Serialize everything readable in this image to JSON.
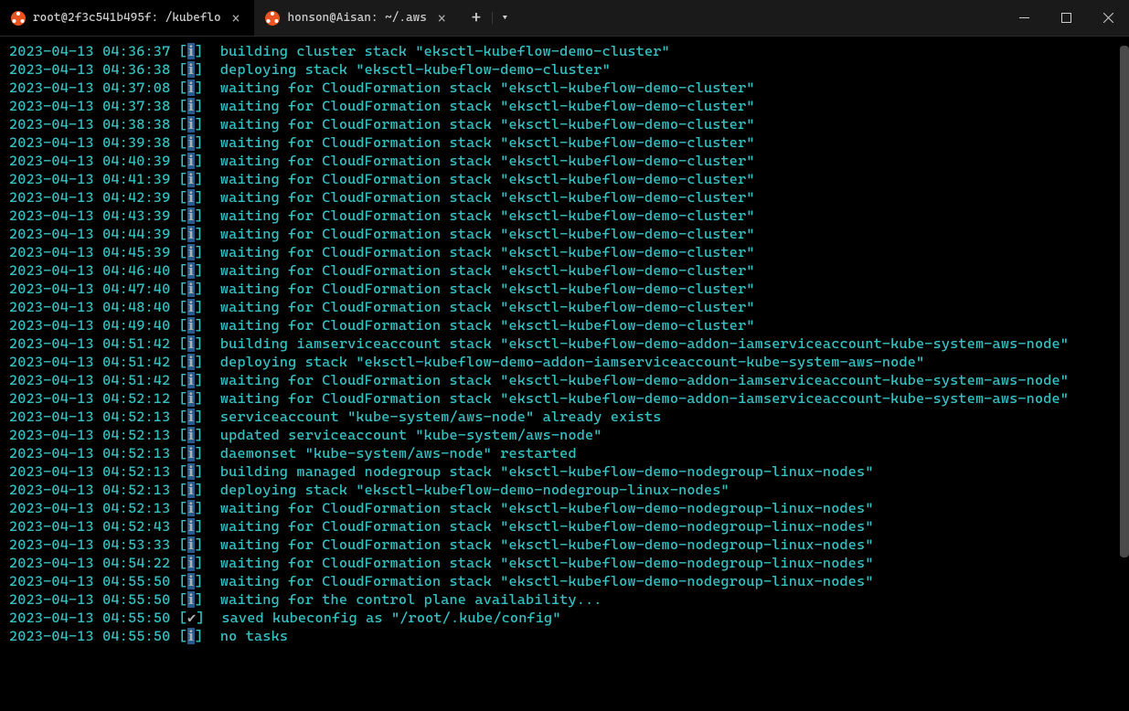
{
  "tabs": [
    {
      "icon": "ubuntu",
      "title": "root@2f3c541b495f: /kubeflo",
      "active": true
    },
    {
      "icon": "ubuntu",
      "title": "honson@Aisan: ~/.aws",
      "active": false
    }
  ],
  "window_controls": {
    "minimize": "minimize",
    "maximize": "maximize",
    "close": "close"
  },
  "log_lines": [
    {
      "ts": "2023-04-13 04:36:37",
      "level": "ℹ",
      "msg": "building cluster stack \"eksctl-kubeflow-demo-cluster\""
    },
    {
      "ts": "2023-04-13 04:36:38",
      "level": "ℹ",
      "msg": "deploying stack \"eksctl-kubeflow-demo-cluster\""
    },
    {
      "ts": "2023-04-13 04:37:08",
      "level": "ℹ",
      "msg": "waiting for CloudFormation stack \"eksctl-kubeflow-demo-cluster\""
    },
    {
      "ts": "2023-04-13 04:37:38",
      "level": "ℹ",
      "msg": "waiting for CloudFormation stack \"eksctl-kubeflow-demo-cluster\""
    },
    {
      "ts": "2023-04-13 04:38:38",
      "level": "ℹ",
      "msg": "waiting for CloudFormation stack \"eksctl-kubeflow-demo-cluster\""
    },
    {
      "ts": "2023-04-13 04:39:38",
      "level": "ℹ",
      "msg": "waiting for CloudFormation stack \"eksctl-kubeflow-demo-cluster\""
    },
    {
      "ts": "2023-04-13 04:40:39",
      "level": "ℹ",
      "msg": "waiting for CloudFormation stack \"eksctl-kubeflow-demo-cluster\""
    },
    {
      "ts": "2023-04-13 04:41:39",
      "level": "ℹ",
      "msg": "waiting for CloudFormation stack \"eksctl-kubeflow-demo-cluster\""
    },
    {
      "ts": "2023-04-13 04:42:39",
      "level": "ℹ",
      "msg": "waiting for CloudFormation stack \"eksctl-kubeflow-demo-cluster\""
    },
    {
      "ts": "2023-04-13 04:43:39",
      "level": "ℹ",
      "msg": "waiting for CloudFormation stack \"eksctl-kubeflow-demo-cluster\""
    },
    {
      "ts": "2023-04-13 04:44:39",
      "level": "ℹ",
      "msg": "waiting for CloudFormation stack \"eksctl-kubeflow-demo-cluster\""
    },
    {
      "ts": "2023-04-13 04:45:39",
      "level": "ℹ",
      "msg": "waiting for CloudFormation stack \"eksctl-kubeflow-demo-cluster\""
    },
    {
      "ts": "2023-04-13 04:46:40",
      "level": "ℹ",
      "msg": "waiting for CloudFormation stack \"eksctl-kubeflow-demo-cluster\""
    },
    {
      "ts": "2023-04-13 04:47:40",
      "level": "ℹ",
      "msg": "waiting for CloudFormation stack \"eksctl-kubeflow-demo-cluster\""
    },
    {
      "ts": "2023-04-13 04:48:40",
      "level": "ℹ",
      "msg": "waiting for CloudFormation stack \"eksctl-kubeflow-demo-cluster\""
    },
    {
      "ts": "2023-04-13 04:49:40",
      "level": "ℹ",
      "msg": "waiting for CloudFormation stack \"eksctl-kubeflow-demo-cluster\""
    },
    {
      "ts": "2023-04-13 04:51:42",
      "level": "ℹ",
      "msg": "building iamserviceaccount stack \"eksctl-kubeflow-demo-addon-iamserviceaccount-kube-system-aws-node\""
    },
    {
      "ts": "2023-04-13 04:51:42",
      "level": "ℹ",
      "msg": "deploying stack \"eksctl-kubeflow-demo-addon-iamserviceaccount-kube-system-aws-node\""
    },
    {
      "ts": "2023-04-13 04:51:42",
      "level": "ℹ",
      "msg": "waiting for CloudFormation stack \"eksctl-kubeflow-demo-addon-iamserviceaccount-kube-system-aws-node\""
    },
    {
      "ts": "2023-04-13 04:52:12",
      "level": "ℹ",
      "msg": "waiting for CloudFormation stack \"eksctl-kubeflow-demo-addon-iamserviceaccount-kube-system-aws-node\""
    },
    {
      "ts": "2023-04-13 04:52:13",
      "level": "ℹ",
      "msg": "serviceaccount \"kube-system/aws-node\" already exists"
    },
    {
      "ts": "2023-04-13 04:52:13",
      "level": "ℹ",
      "msg": "updated serviceaccount \"kube-system/aws-node\""
    },
    {
      "ts": "2023-04-13 04:52:13",
      "level": "ℹ",
      "msg": "daemonset \"kube-system/aws-node\" restarted"
    },
    {
      "ts": "2023-04-13 04:52:13",
      "level": "ℹ",
      "msg": "building managed nodegroup stack \"eksctl-kubeflow-demo-nodegroup-linux-nodes\""
    },
    {
      "ts": "2023-04-13 04:52:13",
      "level": "ℹ",
      "msg": "deploying stack \"eksctl-kubeflow-demo-nodegroup-linux-nodes\""
    },
    {
      "ts": "2023-04-13 04:52:13",
      "level": "ℹ",
      "msg": "waiting for CloudFormation stack \"eksctl-kubeflow-demo-nodegroup-linux-nodes\""
    },
    {
      "ts": "2023-04-13 04:52:43",
      "level": "ℹ",
      "msg": "waiting for CloudFormation stack \"eksctl-kubeflow-demo-nodegroup-linux-nodes\""
    },
    {
      "ts": "2023-04-13 04:53:33",
      "level": "ℹ",
      "msg": "waiting for CloudFormation stack \"eksctl-kubeflow-demo-nodegroup-linux-nodes\""
    },
    {
      "ts": "2023-04-13 04:54:22",
      "level": "ℹ",
      "msg": "waiting for CloudFormation stack \"eksctl-kubeflow-demo-nodegroup-linux-nodes\""
    },
    {
      "ts": "2023-04-13 04:55:50",
      "level": "ℹ",
      "msg": "waiting for CloudFormation stack \"eksctl-kubeflow-demo-nodegroup-linux-nodes\""
    },
    {
      "ts": "2023-04-13 04:55:50",
      "level": "ℹ",
      "msg": "waiting for the control plane availability..."
    },
    {
      "ts": "2023-04-13 04:55:50",
      "level": "✔",
      "msg": "saved kubeconfig as \"/root/.kube/config\""
    },
    {
      "ts": "2023-04-13 04:55:50",
      "level": "ℹ",
      "msg": "no tasks"
    }
  ]
}
